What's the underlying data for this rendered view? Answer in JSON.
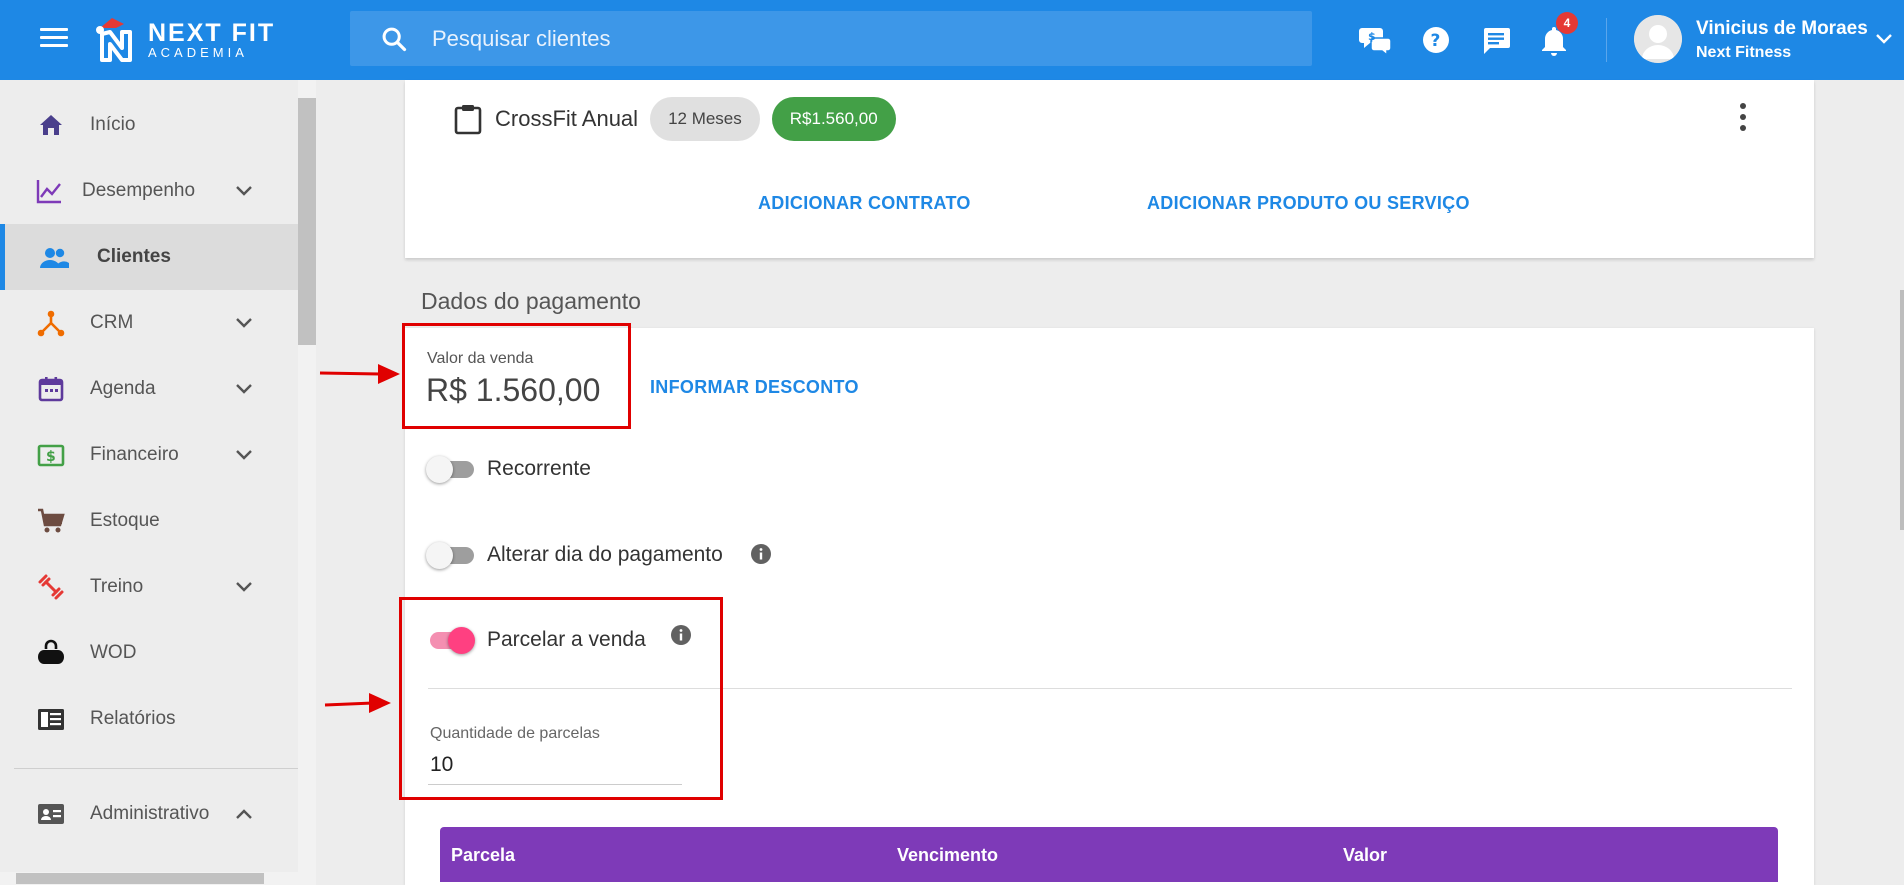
{
  "header": {
    "logo_line1": "NEXT FIT",
    "logo_line2": "ACADEMIA",
    "search_placeholder": "Pesquisar clientes",
    "notification_count": "4",
    "user_name": "Vinicius de Moraes",
    "user_company": "Next Fitness",
    "brand_color": "#1e88e5"
  },
  "sidebar": {
    "items": [
      {
        "label": "Início",
        "icon": "home-icon",
        "has_chevron": false
      },
      {
        "label": "Desempenho",
        "icon": "chart-line-icon",
        "has_chevron": true
      },
      {
        "label": "Clientes",
        "icon": "people-icon",
        "has_chevron": false,
        "active": true
      },
      {
        "label": "CRM",
        "icon": "crm-network-icon",
        "has_chevron": true
      },
      {
        "label": "Agenda",
        "icon": "calendar-icon",
        "has_chevron": true
      },
      {
        "label": "Financeiro",
        "icon": "money-icon",
        "has_chevron": true
      },
      {
        "label": "Estoque",
        "icon": "cart-icon",
        "has_chevron": false
      },
      {
        "label": "Treino",
        "icon": "dumbbell-icon",
        "has_chevron": true
      },
      {
        "label": "WOD",
        "icon": "kettlebell-icon",
        "has_chevron": false
      },
      {
        "label": "Relatórios",
        "icon": "report-icon",
        "has_chevron": false
      },
      {
        "label": "Administrativo",
        "icon": "id-card-icon",
        "has_chevron": true,
        "expanded": true
      }
    ]
  },
  "contract": {
    "name": "CrossFit Anual",
    "duration": "12 Meses",
    "price": "R$1.560,00",
    "add_contract_label": "ADICIONAR CONTRATO",
    "add_product_label": "ADICIONAR PRODUTO OU SERVIÇO"
  },
  "payment": {
    "section_title": "Dados do pagamento",
    "sale_value_label": "Valor da venda",
    "sale_value": "R$ 1.560,00",
    "discount_label": "INFORMAR DESCONTO",
    "toggles": [
      {
        "label": "Recorrente",
        "on": false,
        "info": false
      },
      {
        "label": "Alterar dia do pagamento",
        "on": false,
        "info": true
      },
      {
        "label": "Parcelar a venda",
        "on": true,
        "info": true
      }
    ],
    "installments_label": "Quantidade de parcelas",
    "installments_value": "10",
    "table_headers": [
      "Parcela",
      "Vencimento",
      "Valor"
    ],
    "table_header_color": "#7e3ab8"
  }
}
